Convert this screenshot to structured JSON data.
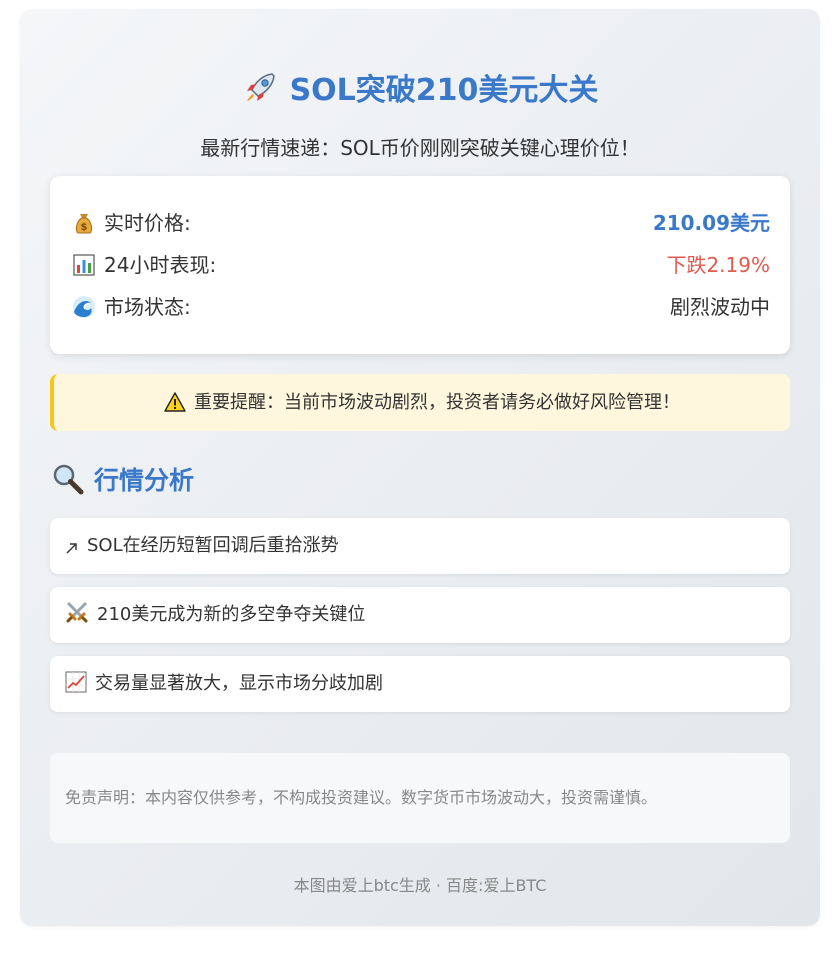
{
  "header": {
    "title": "SOL突破210美元大关",
    "subtitle": "最新行情速递：SOL币价刚刚突破关键心理价位！",
    "title_icon": "rocket-icon"
  },
  "info_card": {
    "rows": [
      {
        "icon": "money-bag-icon",
        "label": "实时价格:",
        "value": "210.09美元"
      },
      {
        "icon": "bar-chart-icon",
        "label": "24小时表现:",
        "value": "下跌2.19%"
      },
      {
        "icon": "wave-icon",
        "label": "市场状态:",
        "value": "剧烈波动中"
      }
    ]
  },
  "warning": {
    "icon": "warning-icon",
    "text": "重要提醒：当前市场波动剧烈，投资者请务必做好风险管理！"
  },
  "analysis": {
    "icon": "magnifier-icon",
    "heading": "行情分析",
    "items": [
      {
        "icon": "arrow-up-right-icon",
        "text": "SOL在经历短暂回调后重拾涨势"
      },
      {
        "icon": "crossed-swords-icon",
        "text": "210美元成为新的多空争夺关键位"
      },
      {
        "icon": "trend-chart-icon",
        "text": "交易量显著放大，显示市场分歧加剧"
      }
    ]
  },
  "disclaimer": "免责声明：本内容仅供参考，不构成投资建议。数字货币市场波动大，投资需谨慎。",
  "footer": "本图由爱上btc生成 · 百度:爱上BTC",
  "colors": {
    "accent": "#3a78c9",
    "down": "#e05a4f",
    "warning_border": "#f5c518",
    "warning_bg": "#fef7dd"
  }
}
